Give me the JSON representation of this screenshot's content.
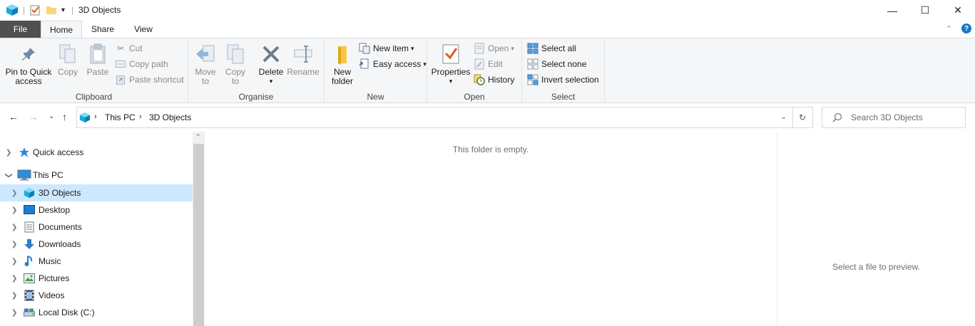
{
  "window": {
    "title": "3D Objects",
    "minimize": "—",
    "maximize": "☐",
    "close": "✕"
  },
  "tabs": {
    "file": "File",
    "home": "Home",
    "share": "Share",
    "view": "View"
  },
  "ribbon": {
    "clipboard": {
      "label": "Clipboard",
      "pin_line1": "Pin to Quick",
      "pin_line2": "access",
      "copy": "Copy",
      "paste": "Paste",
      "cut": "Cut",
      "copy_path": "Copy path",
      "paste_shortcut": "Paste shortcut"
    },
    "organise": {
      "label": "Organise",
      "move_to_1": "Move",
      "move_to_2": "to",
      "copy_to_1": "Copy",
      "copy_to_2": "to",
      "delete": "Delete",
      "rename": "Rename"
    },
    "new": {
      "label": "New",
      "new_folder_1": "New",
      "new_folder_2": "folder",
      "new_item": "New item",
      "easy_access": "Easy access"
    },
    "open": {
      "label": "Open",
      "properties": "Properties",
      "open": "Open",
      "edit": "Edit",
      "history": "History"
    },
    "select": {
      "label": "Select",
      "select_all": "Select all",
      "select_none": "Select none",
      "invert": "Invert selection"
    }
  },
  "address": {
    "crumbs": [
      "This PC",
      "3D Objects"
    ],
    "search_placeholder": "Search 3D Objects"
  },
  "nav": {
    "items": [
      {
        "label": "Quick access",
        "icon": "star-icon"
      },
      {
        "label": "This PC",
        "icon": "computer-icon"
      },
      {
        "label": "3D Objects",
        "icon": "3d-objects-icon"
      },
      {
        "label": "Desktop",
        "icon": "desktop-icon"
      },
      {
        "label": "Documents",
        "icon": "documents-icon"
      },
      {
        "label": "Downloads",
        "icon": "downloads-icon"
      },
      {
        "label": "Music",
        "icon": "music-icon"
      },
      {
        "label": "Pictures",
        "icon": "pictures-icon"
      },
      {
        "label": "Videos",
        "icon": "videos-icon"
      },
      {
        "label": "Local Disk (C:)",
        "icon": "disk-icon"
      }
    ]
  },
  "content": {
    "empty_message": "This folder is empty."
  },
  "preview": {
    "message": "Select a file to preview."
  },
  "colors": {
    "accent": "#1979ca",
    "selected": "#cce8ff",
    "file_tab": "#505050"
  }
}
